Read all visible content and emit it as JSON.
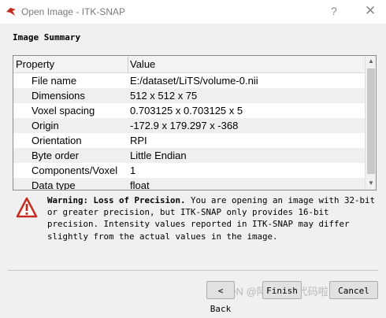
{
  "window": {
    "title": "Open Image - ITK-SNAP",
    "help_symbol": "?",
    "close_symbol": "✕"
  },
  "section_title": "Image Summary",
  "table": {
    "headers": [
      "Property",
      "Value"
    ],
    "rows": [
      {
        "property": "File name",
        "value": "E:/dataset/LiTS/volume-0.nii"
      },
      {
        "property": "Dimensions",
        "value": "512 x 512 x 75"
      },
      {
        "property": "Voxel spacing",
        "value": "0.703125 x 0.703125 x 5"
      },
      {
        "property": "Origin",
        "value": "-172.9 x 179.297 x -368"
      },
      {
        "property": "Orientation",
        "value": "RPI"
      },
      {
        "property": "Byte order",
        "value": "Little Endian"
      },
      {
        "property": "Components/Voxel",
        "value": "1"
      },
      {
        "property": "Data type",
        "value": "float"
      }
    ]
  },
  "warning": {
    "heading": "Warning: Loss of Precision.",
    "body": "You are opening an image with 32-bit or greater precision, but ITK-SNAP only provides 16-bit precision. Intensity values reported in ITK-SNAP may differ slightly from the actual values in the image."
  },
  "buttons": {
    "back": "< Back",
    "finish": "Finish",
    "cancel": "Cancel"
  },
  "watermark": "CSDN @阿正想写代码啦",
  "icons": {
    "app": "itk-snap-logo-icon",
    "warning": "warning-triangle-icon"
  },
  "colors": {
    "warning_red": "#c42b1c",
    "title_gray": "#7a7a7a",
    "alt_row": "#efefef"
  }
}
